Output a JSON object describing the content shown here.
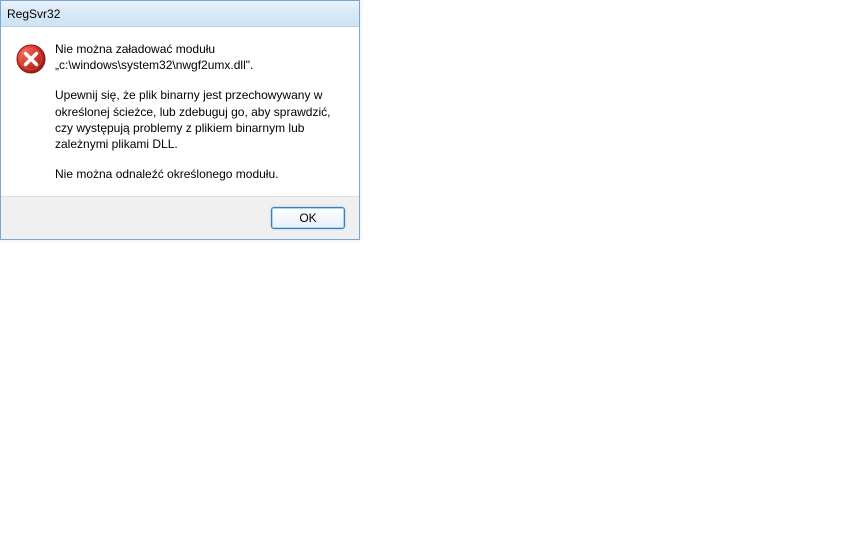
{
  "dialog": {
    "title": "RegSvr32",
    "icon": "error-icon",
    "message_line1": "Nie można załadować modułu „c:\\windows\\system32\\nwgf2umx.dll\".",
    "message_line2": "Upewnij się, że plik binarny jest przechowywany w określonej ścieżce, lub zdebuguj go, aby sprawdzić, czy występują problemy z plikiem binarnym lub zależnymi plikami DLL.",
    "message_line3": "Nie można odnaleźć określonego modułu.",
    "ok_label": "OK"
  },
  "colors": {
    "titlebar_top": "#eaf3fb",
    "titlebar_bottom": "#cfe3f5",
    "border": "#7ba7ce",
    "button_border": "#3c7fb1",
    "button_glow": "#a7d9f5",
    "footer_bg": "#f0f0f0",
    "error_red": "#d9362b"
  }
}
